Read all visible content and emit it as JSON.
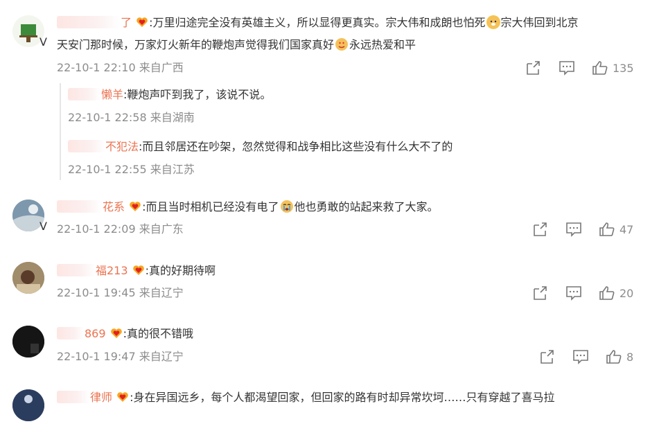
{
  "comments": [
    {
      "name_partial": "了",
      "text_parts": [
        ":万里归途完全没有英雄主义，所以显得更真实。宗大伟和成朗也怕死",
        "宗大伟回到北京"
      ],
      "text_line2_parts": [
        "天安门那时候，万家灯火新年的鞭炮声觉得我们国家真好",
        "永远热爱和平"
      ],
      "meta": "22-10-1 22:10 来自广西",
      "likes": "135",
      "replies": [
        {
          "name_partial": "懒羊",
          "text": ":鞭炮声吓到我了，该说不说。",
          "meta": "22-10-1 22:58 来自湖南"
        },
        {
          "name_partial": "不犯法",
          "text": ":而且邻居还在吵架，忽然觉得和战争相比这些没有什么大不了的",
          "meta": "22-10-1 22:55 来自江苏"
        }
      ]
    },
    {
      "name_partial": "花系",
      "text_parts": [
        ":而且当时相机已经没有电了",
        "他也勇敢的站起来救了大家。"
      ],
      "meta": "22-10-1 22:09 来自广东",
      "likes": "47"
    },
    {
      "name_partial": "福213",
      "text": ":真的好期待啊",
      "meta": "22-10-1 19:45 来自辽宁",
      "likes": "20"
    },
    {
      "name_partial": "869",
      "text": ":真的很不错哦",
      "meta": "22-10-1 19:47 来自辽宁",
      "likes": "8"
    },
    {
      "name_partial": "律师",
      "text": ":身在异国远乡，每个人都渴望回家，但回家的路有时却异常坎坷……只有穿越了喜马拉"
    }
  ],
  "icons": {
    "share": "share-icon",
    "comment": "comment-icon",
    "like": "like-icon",
    "verified": "verified-badge-icon",
    "heart_badge": "heart-badge-icon"
  },
  "colors": {
    "username": "#eb7350",
    "meta": "#8c8c8c",
    "text": "#333333",
    "badge": "#f5a623"
  }
}
